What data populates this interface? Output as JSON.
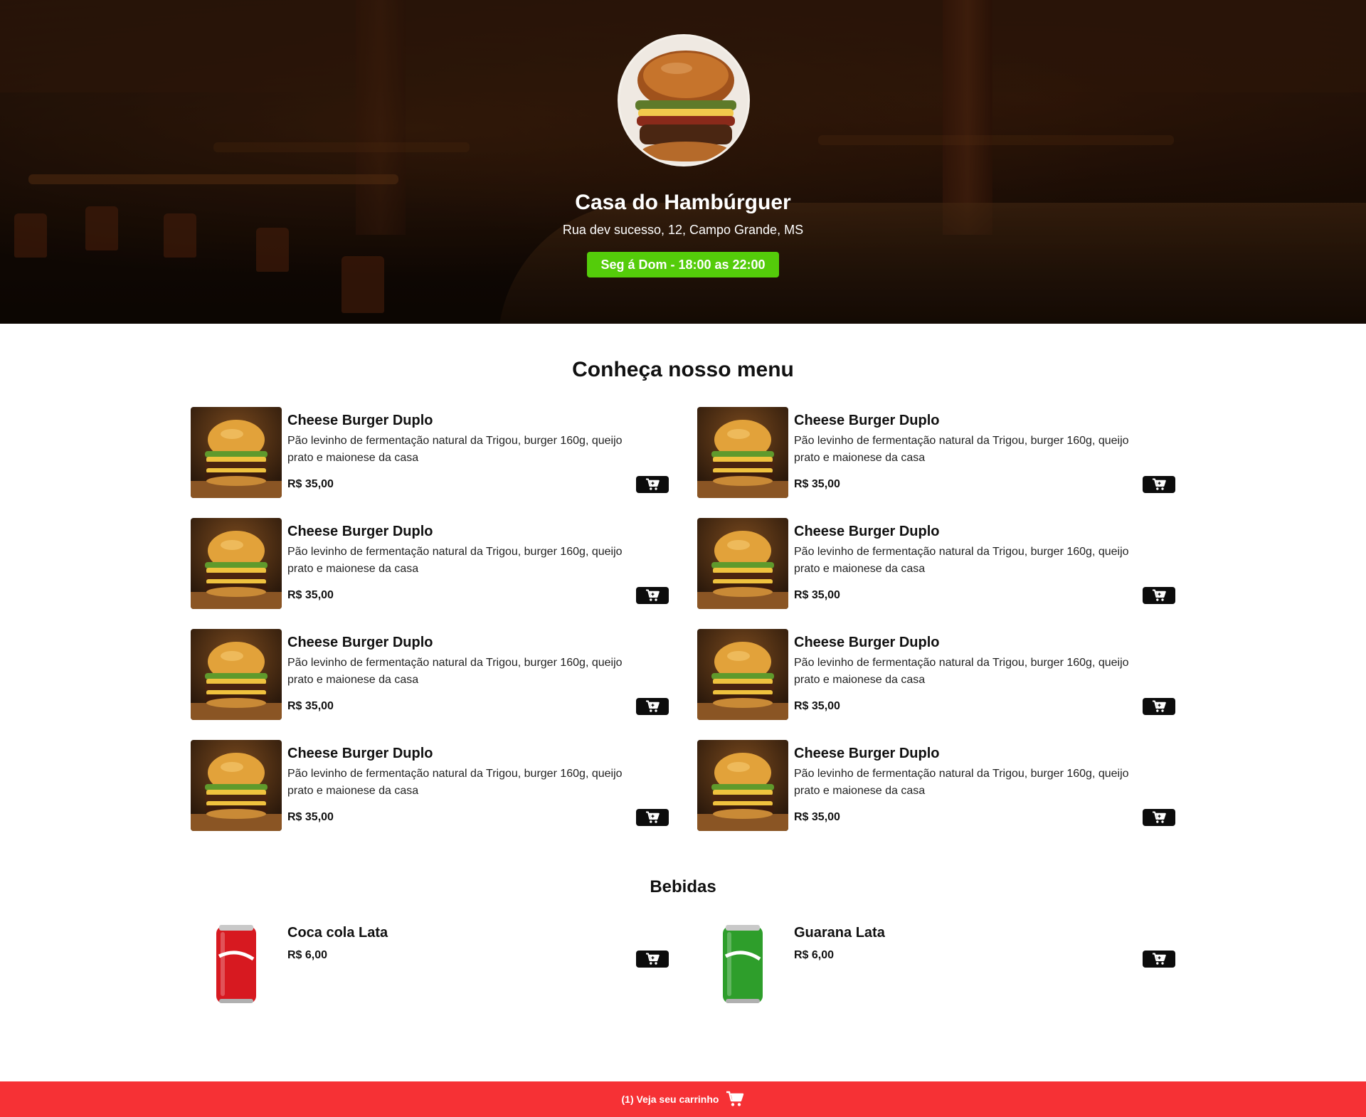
{
  "restaurant": {
    "name": "Casa do Hambúrguer",
    "address": "Rua dev sucesso, 12, Campo Grande, MS",
    "hours": "Seg á Dom - 18:00 as 22:00",
    "hours_color": "#54cc0a"
  },
  "menu": {
    "title": "Conheça nosso menu",
    "items": [
      {
        "name": "Cheese Burger Duplo",
        "description": "Pão levinho de fermentação natural da Trigou, burger 160g, queijo prato e maionese da casa",
        "price": "R$ 35,00"
      },
      {
        "name": "Cheese Burger Duplo",
        "description": "Pão levinho de fermentação natural da Trigou, burger 160g, queijo prato e maionese da casa",
        "price": "R$ 35,00"
      },
      {
        "name": "Cheese Burger Duplo",
        "description": "Pão levinho de fermentação natural da Trigou, burger 160g, queijo prato e maionese da casa",
        "price": "R$ 35,00"
      },
      {
        "name": "Cheese Burger Duplo",
        "description": "Pão levinho de fermentação natural da Trigou, burger 160g, queijo prato e maionese da casa",
        "price": "R$ 35,00"
      },
      {
        "name": "Cheese Burger Duplo",
        "description": "Pão levinho de fermentação natural da Trigou, burger 160g, queijo prato e maionese da casa",
        "price": "R$ 35,00"
      },
      {
        "name": "Cheese Burger Duplo",
        "description": "Pão levinho de fermentação natural da Trigou, burger 160g, queijo prato e maionese da casa",
        "price": "R$ 35,00"
      },
      {
        "name": "Cheese Burger Duplo",
        "description": "Pão levinho de fermentação natural da Trigou, burger 160g, queijo prato e maionese da casa",
        "price": "R$ 35,00"
      },
      {
        "name": "Cheese Burger Duplo",
        "description": "Pão levinho de fermentação natural da Trigou, burger 160g, queijo prato e maionese da casa",
        "price": "R$ 35,00"
      }
    ]
  },
  "drinks": {
    "title": "Bebidas",
    "items": [
      {
        "name": "Coca cola Lata",
        "price": "R$ 6,00",
        "can_color": "#d71920"
      },
      {
        "name": "Guarana Lata",
        "price": "R$ 6,00",
        "can_color": "#2e9e2b"
      }
    ]
  },
  "footer": {
    "cart_label": "(1) Veja seu carrinho",
    "background": "#f63135"
  },
  "icons": {
    "cart": "cart-plus-icon",
    "footer_cart": "shopping-cart-icon"
  }
}
